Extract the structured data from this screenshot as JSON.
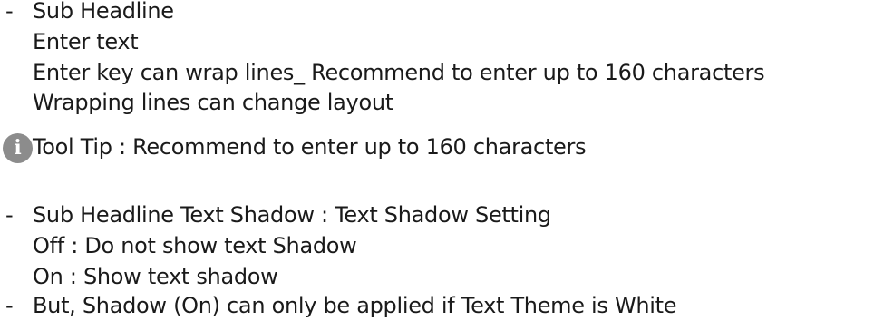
{
  "section1": {
    "bullet": "-",
    "title": "Sub Headline",
    "lines": [
      "Enter text",
      "Enter key can wrap lines_ Recommend to enter up to 160 characters",
      "Wrapping lines can change layout"
    ],
    "tooltip": {
      "icon": "info-icon",
      "icon_color": "#8c8c8c",
      "icon_glyph": "i",
      "text": "Tool Tip : Recommend to enter up to 160 characters"
    }
  },
  "section2": {
    "bullet": "-",
    "title": "Sub Headline Text Shadow : Text Shadow Setting",
    "lines": [
      "Off : Do not show text Shadow",
      "On : Show text shadow"
    ]
  },
  "section3": {
    "bullet": "-",
    "title": "But, Shadow (On) can only be applied if Text Theme is White"
  }
}
